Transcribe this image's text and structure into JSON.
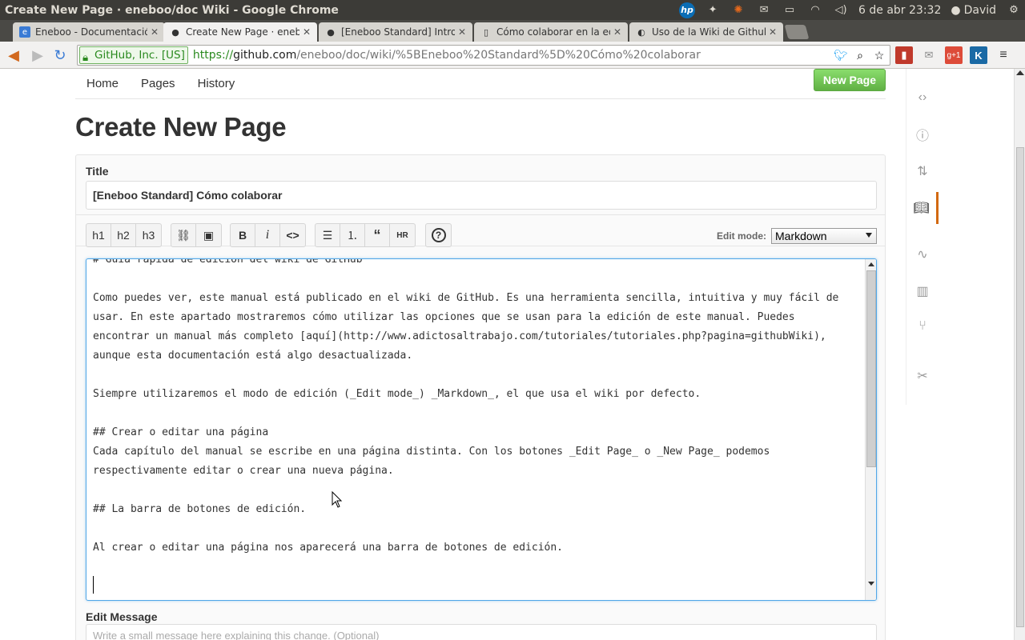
{
  "os": {
    "window_title": "Create New Page · eneboo/doc Wiki - Google Chrome",
    "datetime": "6 de abr 23:32",
    "user": "David"
  },
  "tabs": [
    {
      "label": "Eneboo - Documentación",
      "icon": "eneboo-icon"
    },
    {
      "label": "Create New Page · eneboo/doc",
      "icon": "github-icon"
    },
    {
      "label": "[Eneboo Standard] Introd",
      "icon": "github-icon"
    },
    {
      "label": "Cómo colaborar en la edic",
      "icon": "page-icon"
    },
    {
      "label": "Uso de la Wiki de Github.",
      "icon": "penguin-icon"
    }
  ],
  "address": {
    "ev_label": "GitHub, Inc. [US]",
    "scheme": "https://",
    "host": "github.com",
    "path": "/eneboo/doc/wiki/%5BEneboo%20Standard%5D%20Cómo%20colaborar"
  },
  "wiki_nav": {
    "home": "Home",
    "pages": "Pages",
    "history": "History",
    "new_page": "New Page"
  },
  "page_title": "Create New Page",
  "form": {
    "title_label": "Title",
    "title_value": "[Eneboo Standard] Cómo colaborar",
    "edit_mode_label": "Edit mode:",
    "edit_mode_value": "Markdown",
    "edit_message_label": "Edit Message",
    "edit_message_placeholder": "Write a small message here explaining this change. (Optional)"
  },
  "toolbar_buttons": {
    "h1": "h1",
    "h2": "h2",
    "h3": "h3",
    "bold": "B",
    "italic": "i",
    "code": "<>",
    "hr": "HR",
    "help": "?"
  },
  "editor_lines": [
    "# Guía rápida de edición del wiki de GitHub",
    "",
    "Como puedes ver, este manual está publicado en el wiki de GitHub. Es una herramienta sencilla, intuitiva y muy fácil de",
    "usar. En este apartado mostraremos cómo utilizar las opciones que se usan para la edición de este manual. Puedes",
    "encontrar un manual más completo [aquí](http://www.adictosaltrabajo.com/tutoriales/tutoriales.php?pagina=githubWiki),",
    "aunque esta documentación está algo desactualizada.",
    "",
    "Siempre utilizaremos el modo de edición (_Edit mode_) _Markdown_, el que usa el wiki por defecto.",
    "",
    "## Crear o editar una página",
    "Cada capítulo del manual se escribe en una página distinta. Con los botones _Edit Page_ o _New Page_ podemos",
    "respectivamente editar o crear una nueva página.",
    "",
    "## La barra de botones de edición.",
    "",
    "Al crear o editar una página nos aparecerá una barra de botones de edición.",
    ""
  ],
  "colors": {
    "accent_green": "#60b044",
    "focus_blue": "#51a7e8",
    "active_orange": "#d26911"
  }
}
